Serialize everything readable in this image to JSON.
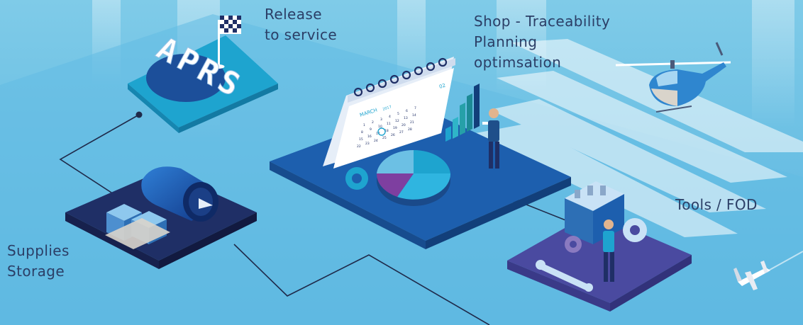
{
  "labels": {
    "release": [
      "Release",
      "to service"
    ],
    "shop": [
      "Shop - Traceability",
      "Planning",
      "optimsation"
    ],
    "tools": [
      "Tools / FOD"
    ],
    "supplies": [
      "Supplies",
      "Storage"
    ]
  },
  "aprs_text": "APRS",
  "calendar": {
    "month": "MARCH",
    "year": "2017",
    "day_headers": [
      "SUN",
      "MON",
      "TUE",
      "WED",
      "THU",
      "FRI",
      "SAT"
    ],
    "days": [
      "1",
      "2",
      "3",
      "4",
      "5",
      "6",
      "7",
      "8",
      "9",
      "10",
      "11",
      "12",
      "13",
      "14",
      "15",
      "16",
      "17",
      "18",
      "19",
      "20",
      "21",
      "22",
      "23",
      "24",
      "25",
      "26",
      "27",
      "28"
    ],
    "highlight_day": "9",
    "tag": "02"
  },
  "colors": {
    "background": "#6cc0e4",
    "label_text": "#2b3e66",
    "platform_dark_blue": "#1d5fae",
    "platform_navy": "#1f2f66",
    "platform_purple": "#4a4aa0",
    "platform_teal": "#1ea4cf",
    "connector_line": "#1f2a4a"
  },
  "icons": [
    "checkered-flag-icon",
    "jet-engine-icon",
    "calendar-icon",
    "pie-chart-icon",
    "bar-chart-icon",
    "gear-icon",
    "wrench-icon",
    "toolbox-icon",
    "helicopter-icon",
    "airplane-icon",
    "technician-icon",
    "cargo-boxes-icon"
  ]
}
